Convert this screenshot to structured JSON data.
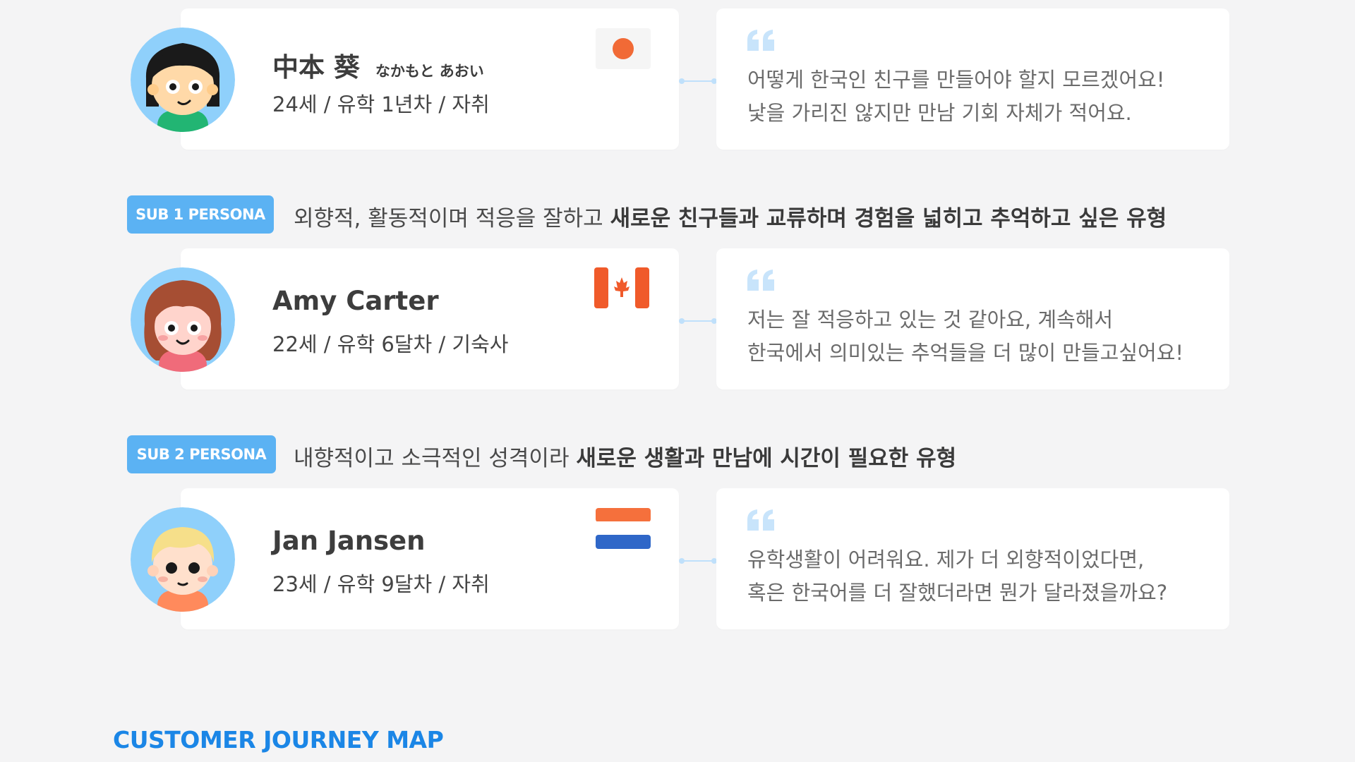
{
  "personas": [
    {
      "name": "中本 葵",
      "name_kana": "なかもと あおい",
      "meta": "24세 / 유학 1년차 / 자취",
      "flag_icon": "japan-flag-icon",
      "quote_lines": [
        "어떻게 한국인 친구를 만들어야 할지 모르겠어요!",
        "낯을 가리진 않지만 만남 기회 자체가 적어요."
      ]
    },
    {
      "badge": "SUB 1 PERSONA",
      "desc_plain": "외향적, 활동적이며 적응을 잘하고 ",
      "desc_bold": "새로운 친구들과 교류하며 경험을 넓히고 추억하고 싶은 유형",
      "name": "Amy Carter",
      "meta": "22세 / 유학 6달차 / 기숙사",
      "flag_icon": "canada-flag-icon",
      "quote_lines": [
        "저는 잘 적응하고 있는 것 같아요, 계속해서",
        "한국에서 의미있는 추억들을 더 많이 만들고싶어요!"
      ]
    },
    {
      "badge": "SUB 2 PERSONA",
      "desc_plain": "내향적이고 소극적인 성격이라 ",
      "desc_bold": "새로운 생활과 만남에 시간이 필요한 유형",
      "name": "Jan Jansen",
      "meta": "23세 / 유학 9달차 / 자취",
      "flag_icon": "netherlands-flag-icon",
      "quote_lines": [
        "유학생활이 어려워요. 제가 더 외향적이었다면,",
        "혹은 한국어를 더 잘했더라면 뭔가 달라졌을까요?"
      ]
    }
  ],
  "section_title": "CUSTOMER JOURNEY MAP",
  "colors": {
    "accent": "#5bb2f3",
    "title_blue": "#1b86e6",
    "background": "#f4f4f5",
    "japan_red": "#f16a36",
    "canada_red": "#f05a2a",
    "nl_red": "#f5703c",
    "nl_blue": "#2f67c8"
  }
}
